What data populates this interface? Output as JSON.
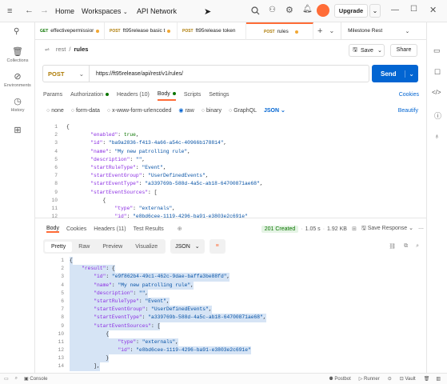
{
  "titlebar": {
    "home": "Home",
    "workspaces": "Workspaces",
    "api_network": "API Network",
    "upgrade": "Upgrade"
  },
  "leftnav": [
    {
      "label": "Collections",
      "icon": "collections-icon"
    },
    {
      "label": "Environments",
      "icon": "environments-icon"
    },
    {
      "label": "History",
      "icon": "history-icon"
    },
    {
      "label": "",
      "icon": "apps-icon"
    }
  ],
  "tabs": [
    {
      "method": "GET",
      "name": "effectivepermissior",
      "method_color": "#0b7500",
      "dot": "#f1a733"
    },
    {
      "method": "POST",
      "name": "ft95release basic t",
      "method_color": "#ad7a03",
      "dot": "#f1a733"
    },
    {
      "method": "POST",
      "name": "ft95release token",
      "method_color": "#ad7a03",
      "dot": ""
    },
    {
      "method": "POST",
      "name": "rules",
      "method_color": "#ad7a03",
      "dot": "#f1a733"
    }
  ],
  "environment": "Milestone Rest",
  "breadcrumb": {
    "parent": "rest",
    "sep": "/",
    "current": "rules"
  },
  "save_label": "Save",
  "share_label": "Share",
  "request": {
    "method": "POST",
    "url": "https://ft95release/api/rest/v1/rules/",
    "send": "Send"
  },
  "req_tabs": {
    "params": "Params",
    "authorization": "Authorization",
    "headers": "Headers (10)",
    "body": "Body",
    "scripts": "Scripts",
    "settings": "Settings",
    "cookies": "Cookies"
  },
  "body_types": {
    "none": "none",
    "form_data": "form-data",
    "urlencoded": "x-www-form-urlencoded",
    "raw": "raw",
    "binary": "binary",
    "graphql": "GraphQL",
    "format": "JSON",
    "beautify": "Beautify"
  },
  "request_body": [
    {
      "n": "1",
      "t": "{"
    },
    {
      "n": "2",
      "t": "        \"enabled\": true,"
    },
    {
      "n": "3",
      "t": "        \"id\": \"ba9a2836-f413-4a66-a54c-40966b178814\","
    },
    {
      "n": "4",
      "t": "        \"name\": \"My new patrolling rule\","
    },
    {
      "n": "5",
      "t": "        \"description\": \"\","
    },
    {
      "n": "6",
      "t": "        \"startRuleType\": \"Event\","
    },
    {
      "n": "7",
      "t": "        \"startEventGroup\": \"UserDefinedEvents\","
    },
    {
      "n": "8",
      "t": "        \"startEventType\": \"a339769b-588d-4a5c-ab18-64700871ae68\","
    },
    {
      "n": "9",
      "t": "        \"startEventSources\": ["
    },
    {
      "n": "10",
      "t": "            {"
    },
    {
      "n": "11",
      "t": "                \"type\": \"externals\","
    },
    {
      "n": "12",
      "t": "                \"id\": \"e8bd6cee-1119-4296-ba91-e3803e2c691e\""
    }
  ],
  "resp_tabs": {
    "body": "Body",
    "cookies": "Cookies",
    "headers": "Headers (11)",
    "test_results": "Test Results"
  },
  "response_meta": {
    "status": "201 Created",
    "time": "1.05 s",
    "size": "1.92 KB",
    "save": "Save Response"
  },
  "resp_view": {
    "pretty": "Pretty",
    "raw": "Raw",
    "preview": "Preview",
    "visualize": "Visualize",
    "format": "JSON"
  },
  "response_body": [
    {
      "n": "1",
      "t": "{"
    },
    {
      "n": "2",
      "t": "    \"result\": {"
    },
    {
      "n": "3",
      "t": "        \"id\": \"e9f862b4-49c1-462c-9dae-baffa3be88fd\","
    },
    {
      "n": "4",
      "t": "        \"name\": \"My new patrolling rule\","
    },
    {
      "n": "5",
      "t": "        \"description\": \"\","
    },
    {
      "n": "6",
      "t": "        \"startRuleType\": \"Event\","
    },
    {
      "n": "7",
      "t": "        \"startEventGroup\": \"UserDefinedEvents\","
    },
    {
      "n": "8",
      "t": "        \"startEventType\": \"a339769b-588d-4a5c-ab18-64700871ae68\","
    },
    {
      "n": "9",
      "t": "        \"startEventSources\": ["
    },
    {
      "n": "10",
      "t": "            {"
    },
    {
      "n": "11",
      "t": "                \"type\": \"externals\","
    },
    {
      "n": "12",
      "t": "                \"id\": \"e8bd6cee-1119-4296-ba91-e3803e2c691e\""
    },
    {
      "n": "13",
      "t": "            }"
    },
    {
      "n": "14",
      "t": "        ],"
    }
  ],
  "statusbar": {
    "console": "Console",
    "postbot": "Postbot",
    "runner": "Runner",
    "vault": "Vault"
  },
  "colors": {
    "accent": "#ff6c37",
    "send": "#0265d2",
    "status_ok": "#0b7500"
  }
}
